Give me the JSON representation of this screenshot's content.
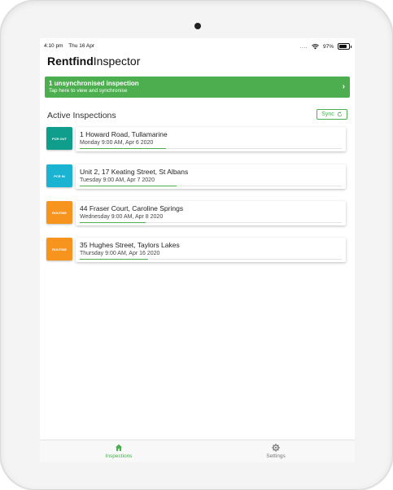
{
  "status_bar": {
    "time": "4:10 pm",
    "date": "Thu 16 Apr",
    "signal": "....",
    "battery": "97%"
  },
  "header": {
    "brand_bold": "Rentfind",
    "brand_light": "Inspector"
  },
  "banner": {
    "title": "1 unsynchronised inspection",
    "subtitle": "Tap here to view and synchronise",
    "chevron": "›",
    "color": "#4cae4f"
  },
  "section": {
    "title": "Active Inspections",
    "sync_label": "Sync"
  },
  "inspections": [
    {
      "badge": "PCR OUT",
      "badge_color": "#0f9e8b",
      "address": "1 Howard Road, Tullamarine",
      "date": "Monday 9:00 AM, Apr 6 2020",
      "progress": 0.33
    },
    {
      "badge": "PCR IN",
      "badge_color": "#1ab3d1",
      "address": "Unit 2, 17 Keating Street, St Albans",
      "date": "Tuesday 9:00 AM, Apr 7 2020",
      "progress": 0.37
    },
    {
      "badge": "ROUTINE",
      "badge_color": "#f7941d",
      "address": "44 Fraser Court, Caroline Springs",
      "date": "Wednesday 9:00 AM, Apr 8 2020",
      "progress": 0.25
    },
    {
      "badge": "ROUTINE",
      "badge_color": "#f7941d",
      "address": "35 Hughes Street, Taylors Lakes",
      "date": "Thursday 9:00 AM, Apr 16 2020",
      "progress": 0.26
    }
  ],
  "tabs": [
    {
      "label": "Inspections",
      "icon": "home-icon",
      "active": true
    },
    {
      "label": "Settings",
      "icon": "gear-icon",
      "active": false
    }
  ]
}
